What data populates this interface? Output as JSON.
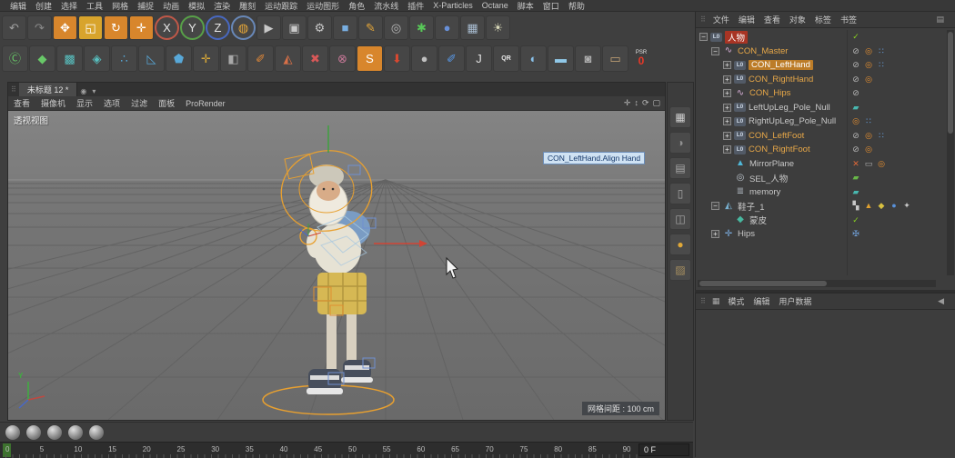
{
  "menubar": {
    "items": [
      "编辑",
      "创建",
      "选择",
      "工具",
      "网格",
      "捕捉",
      "动画",
      "模拟",
      "渲染",
      "雕刻",
      "运动跟踪",
      "运动图形",
      "角色",
      "流水线",
      "插件",
      "X-Particles",
      "Octane",
      "脚本",
      "窗口",
      "帮助"
    ]
  },
  "toolbar_row1": [
    {
      "name": "undo-icon",
      "glyph": "↶",
      "fg": "#a0a0a0"
    },
    {
      "name": "redo-icon",
      "glyph": "↷",
      "fg": "#8a8a8a"
    },
    {
      "name": "move-tool-icon",
      "glyph": "✥",
      "fg": "#ffffff",
      "bg": "#d8862c"
    },
    {
      "name": "scale-tool-icon",
      "glyph": "◱",
      "fg": "#ffffff",
      "bg": "#d8a42c"
    },
    {
      "name": "rotate-tool-icon",
      "glyph": "↻",
      "fg": "#ffffff",
      "bg": "#d8862c"
    },
    {
      "name": "last-tool-icon",
      "glyph": "✛",
      "fg": "#ffffff",
      "bg": "#d8862c"
    },
    {
      "name": "x-axis-lock-icon",
      "glyph": "X",
      "fg": "#e8e8e8",
      "shape": "circle",
      "ring": "#c05848"
    },
    {
      "name": "y-axis-lock-icon",
      "glyph": "Y",
      "fg": "#e8e8e8",
      "shape": "circle",
      "ring": "#58a048"
    },
    {
      "name": "z-axis-lock-icon",
      "glyph": "Z",
      "fg": "#e8e8e8",
      "shape": "circle",
      "ring": "#4868c0"
    },
    {
      "name": "coordinate-system-icon",
      "glyph": "◍",
      "fg": "#e8a838",
      "shape": "circle",
      "ring": "#6888b8"
    },
    {
      "name": "render-view-icon",
      "glyph": "▶",
      "fg": "#c8c8c8"
    },
    {
      "name": "render-picture-viewer-icon",
      "glyph": "▣",
      "fg": "#c8c8c8"
    },
    {
      "name": "render-settings-icon",
      "glyph": "⚙",
      "fg": "#c8c8c8"
    },
    {
      "name": "cube-primitive-icon",
      "glyph": "■",
      "fg": "#78aee0"
    },
    {
      "name": "spline-pen-icon",
      "glyph": "✎",
      "fg": "#e8a838"
    },
    {
      "name": "torus-primitive-icon",
      "glyph": "◎",
      "fg": "#b8b8b8"
    },
    {
      "name": "generator-icon",
      "glyph": "✱",
      "fg": "#58c858"
    },
    {
      "name": "volume-builder-icon",
      "glyph": "●",
      "fg": "#6890d8"
    },
    {
      "name": "array-mograph-icon",
      "glyph": "▦",
      "fg": "#a8bcd0"
    },
    {
      "name": "light-object-icon",
      "glyph": "☀",
      "fg": "#d8d8b8"
    }
  ],
  "toolbar_row2": [
    {
      "name": "make-editable-icon",
      "glyph": "Ⓒ",
      "fg": "#68c868"
    },
    {
      "name": "model-mode-icon",
      "glyph": "◆",
      "fg": "#68c868"
    },
    {
      "name": "texture-mode-icon",
      "glyph": "▩",
      "fg": "#58c0c0"
    },
    {
      "name": "workplane-mode-icon",
      "glyph": "◈",
      "fg": "#58c0c0"
    },
    {
      "name": "point-mode-icon",
      "glyph": "∴",
      "fg": "#58a8d8"
    },
    {
      "name": "edge-mode-icon",
      "glyph": "◺",
      "fg": "#58a8d8"
    },
    {
      "name": "polygon-mode-icon",
      "glyph": "⬟",
      "fg": "#58a8d8"
    },
    {
      "name": "axis-mode-icon",
      "glyph": "✛",
      "fg": "#d8a838"
    },
    {
      "name": "solo-mode-icon",
      "glyph": "◧",
      "fg": "#a8a8a8"
    },
    {
      "name": "paint-tool-icon",
      "glyph": "✐",
      "fg": "#e08838"
    },
    {
      "name": "knife-tool-icon",
      "glyph": "◭",
      "fg": "#d87048"
    },
    {
      "name": "delete-tool-icon",
      "glyph": "✖",
      "fg": "#d85858"
    },
    {
      "name": "magnet-tool-icon",
      "glyph": "⊗",
      "fg": "#c87898"
    },
    {
      "name": "sculpt-tool-icon",
      "glyph": "S",
      "fg": "#ffffff",
      "bg": "#d8862c"
    },
    {
      "name": "drop-to-floor-icon",
      "glyph": "⬇",
      "fg": "#d84830"
    },
    {
      "name": "material-ball-icon",
      "glyph": "●",
      "fg": "#c0c0c0"
    },
    {
      "name": "bodypaint-brush-icon",
      "glyph": "✐",
      "fg": "#5898e8"
    },
    {
      "name": "j-plugin-icon",
      "glyph": "J",
      "fg": "#e0e0e0"
    },
    {
      "name": "qr-plugin-icon",
      "glyph": "QR",
      "fg": "#e8e8e8",
      "small": true
    },
    {
      "name": "sky-object-icon",
      "glyph": "◐",
      "fg": "#88c0e8"
    },
    {
      "name": "floor-object-icon",
      "glyph": "▬",
      "fg": "#90c8e8"
    },
    {
      "name": "camera-object-icon",
      "glyph": "◙",
      "fg": "#b0b0b0"
    },
    {
      "name": "stage-object-icon",
      "glyph": "▭",
      "fg": "#c8a878"
    }
  ],
  "psr": {
    "label": "PSR",
    "value": "0",
    "color": "#e83828"
  },
  "viewport": {
    "tab_title": "未标题 12 *",
    "tab_icons": [
      {
        "name": "tab-target-icon",
        "glyph": "◉"
      },
      {
        "name": "tab-menu-arrow-icon",
        "glyph": "▾"
      }
    ],
    "menu_items": [
      "查看",
      "摄像机",
      "显示",
      "选项",
      "过滤",
      "面板",
      "ProRender"
    ],
    "corner_icons": [
      {
        "name": "pan-view-icon",
        "glyph": "✛"
      },
      {
        "name": "zoom-view-icon",
        "glyph": "↕"
      },
      {
        "name": "rotate-view-icon",
        "glyph": "⟳"
      },
      {
        "name": "toggle-view-icon",
        "glyph": "▢"
      }
    ],
    "view_label": "透视视图",
    "tooltip": "CON_LeftHand.Align Hand",
    "grid_spacing_label": "网格间距 : 100 cm",
    "axis_labels": {
      "x": "X",
      "y": "Y",
      "z": "Z"
    }
  },
  "side_strip": [
    {
      "name": "layout-cube-icon",
      "glyph": "▦",
      "fg": "#d0d0d0"
    },
    {
      "name": "shaded-sphere-icon",
      "glyph": "◑",
      "fg": "#909090"
    },
    {
      "name": "layer-stack-icon",
      "glyph": "▤",
      "fg": "#a8a8a8"
    },
    {
      "name": "page-icon",
      "glyph": "▯",
      "fg": "#a8a8a8"
    },
    {
      "name": "split-panel-icon",
      "glyph": "◫",
      "fg": "#a8a8a8"
    },
    {
      "name": "gold-material-icon",
      "glyph": "●",
      "fg": "#e0a838"
    },
    {
      "name": "texture-tile-icon",
      "glyph": "▨",
      "fg": "#a89060"
    }
  ],
  "object_manager": {
    "menu_items": [
      "文件",
      "编辑",
      "查看",
      "对象",
      "标签",
      "书签"
    ],
    "filter_glyph": "▤",
    "object_icons": {
      "null": {
        "glyph": "L0",
        "color": "#ccd6e4"
      },
      "spline": {
        "glyph": "∿",
        "color": "#d8b0d8"
      },
      "mirror": {
        "glyph": "▲",
        "color": "#50b8d8"
      },
      "selection": {
        "glyph": "◎",
        "color": "#c0c8d0"
      },
      "memory": {
        "glyph": "≣",
        "color": "#b0b8c0"
      },
      "mesh": {
        "glyph": "◭",
        "color": "#78b0d0"
      },
      "skin": {
        "glyph": "◆",
        "color": "#48b8a0"
      },
      "joint": {
        "glyph": "✛",
        "color": "#78a8d8"
      }
    },
    "tag_icons": {
      "slash-gray": {
        "glyph": "⊘",
        "color": "#b8b8b8"
      },
      "target-orange": {
        "glyph": "◎",
        "color": "#e89030"
      },
      "dots-blue": {
        "glyph": "∷",
        "color": "#68a0e0"
      },
      "check-green": {
        "glyph": "✓",
        "color": "#88d020"
      },
      "x-orange": {
        "glyph": "✕",
        "color": "#e06838"
      },
      "teal-chip": {
        "glyph": "▰",
        "color": "#48b8b0"
      },
      "green-chip": {
        "glyph": "▰",
        "color": "#68b848"
      },
      "checker": {
        "glyph": "▚",
        "color": "#c8c8c8"
      },
      "triangle-orange": {
        "glyph": "▲",
        "color": "#e0a030"
      },
      "sphere-blue": {
        "glyph": "●",
        "color": "#5890d8"
      },
      "diamond-yellow": {
        "glyph": "◆",
        "color": "#d8c040"
      },
      "figure-white": {
        "glyph": "✦",
        "color": "#c8c8c8"
      },
      "panel-gray": {
        "glyph": "▭",
        "color": "#b0b0b0"
      },
      "cross-blue": {
        "glyph": "✠",
        "color": "#70a0d8"
      }
    },
    "rows": [
      {
        "label": "人物",
        "level": 0,
        "expander": "minus",
        "icon": "null",
        "style": "layer-red",
        "tags": [
          "check-green"
        ]
      },
      {
        "label": "CON_Master",
        "level": 1,
        "expander": "minus",
        "icon": "spline",
        "style": "orange",
        "tags": [
          "slash-gray",
          "target-orange",
          "dots-blue"
        ]
      },
      {
        "label": "CON_LeftHand",
        "level": 2,
        "expander": "plus",
        "icon": "null",
        "style": "selected",
        "tags": [
          "slash-gray",
          "target-orange",
          "dots-blue"
        ]
      },
      {
        "label": "CON_RightHand",
        "level": 2,
        "expander": "plus",
        "icon": "null",
        "style": "orange",
        "tags": [
          "slash-gray",
          "target-orange"
        ]
      },
      {
        "label": "CON_Hips",
        "level": 2,
        "expander": "plus",
        "icon": "spline",
        "style": "orange",
        "tags": [
          "slash-gray"
        ]
      },
      {
        "label": "LeftUpLeg_Pole_Null",
        "level": 2,
        "expander": "plus",
        "icon": "null",
        "style": "plain",
        "tags": [
          "teal-chip"
        ]
      },
      {
        "label": "RightUpLeg_Pole_Null",
        "level": 2,
        "expander": "plus",
        "icon": "null",
        "style": "plain",
        "tags": [
          "target-orange",
          "dots-blue"
        ]
      },
      {
        "label": "CON_LeftFoot",
        "level": 2,
        "expander": "plus",
        "icon": "null",
        "style": "orange",
        "tags": [
          "slash-gray",
          "target-orange",
          "dots-blue"
        ]
      },
      {
        "label": "CON_RightFoot",
        "level": 2,
        "expander": "plus",
        "icon": "null",
        "style": "orange",
        "tags": [
          "slash-gray",
          "target-orange"
        ]
      },
      {
        "label": "MirrorPlane",
        "level": 2,
        "expander": "none",
        "icon": "mirror",
        "style": "plain",
        "tags": [
          "x-orange",
          "panel-gray",
          "target-orange"
        ]
      },
      {
        "label": "SEL_人物",
        "level": 2,
        "expander": "none",
        "icon": "selection",
        "style": "plain",
        "tags": [
          "green-chip"
        ]
      },
      {
        "label": "memory",
        "level": 2,
        "expander": "none",
        "icon": "memory",
        "style": "plain",
        "tags": [
          "teal-chip"
        ]
      },
      {
        "label": "鞋子_1",
        "level": 1,
        "expander": "minus",
        "icon": "mesh",
        "style": "plain",
        "tags": [
          "checker",
          "triangle-orange",
          "diamond-yellow",
          "sphere-blue",
          "figure-white"
        ]
      },
      {
        "label": "蒙皮",
        "level": 2,
        "expander": "none",
        "icon": "skin",
        "style": "plain",
        "tags": [
          "check-green"
        ]
      },
      {
        "label": "Hips",
        "level": 1,
        "expander": "plus",
        "icon": "joint",
        "style": "plain",
        "tags": [
          "cross-blue"
        ]
      }
    ]
  },
  "attribute_manager": {
    "grid_glyph": "▦",
    "tabs": [
      "模式",
      "编辑",
      "用户数据"
    ],
    "collapse_icon": "◀"
  },
  "timeline": {
    "tick_labels": [
      "0",
      "5",
      "10",
      "15",
      "20",
      "25",
      "30",
      "35",
      "40",
      "45",
      "50",
      "55",
      "60",
      "65",
      "70",
      "75",
      "80",
      "85",
      "90"
    ],
    "frame_field": "0 F"
  }
}
